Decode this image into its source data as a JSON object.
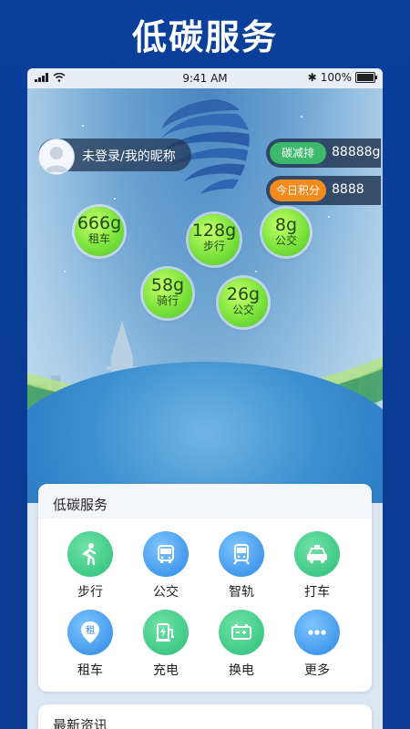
{
  "banner": {
    "title": "低碳服务"
  },
  "status_bar": {
    "time": "9:41 AM",
    "battery": "100%"
  },
  "user": {
    "name": "未登录/我的昵称"
  },
  "stats": [
    {
      "label": "碳减排",
      "value": "88888g",
      "color": "#3cb96b"
    },
    {
      "label": "今日积分",
      "value": "8888",
      "color": "#f28a1c"
    }
  ],
  "bubbles": [
    {
      "value": "666g",
      "label": "租车"
    },
    {
      "value": "128g",
      "label": "步行"
    },
    {
      "value": "8g",
      "label": "公交"
    },
    {
      "value": "58g",
      "label": "骑行"
    },
    {
      "value": "26g",
      "label": "公交"
    }
  ],
  "services": {
    "title": "低碳服务",
    "items": [
      {
        "label": "步行",
        "icon": "walk-icon"
      },
      {
        "label": "公交",
        "icon": "bus-icon"
      },
      {
        "label": "智轨",
        "icon": "tram-icon"
      },
      {
        "label": "打车",
        "icon": "taxi-icon"
      },
      {
        "label": "租车",
        "icon": "rent-car-icon"
      },
      {
        "label": "充电",
        "icon": "charging-icon"
      },
      {
        "label": "换电",
        "icon": "battery-swap-icon"
      },
      {
        "label": "更多",
        "icon": "more-icon"
      }
    ]
  },
  "news": {
    "title": "最新资讯"
  }
}
